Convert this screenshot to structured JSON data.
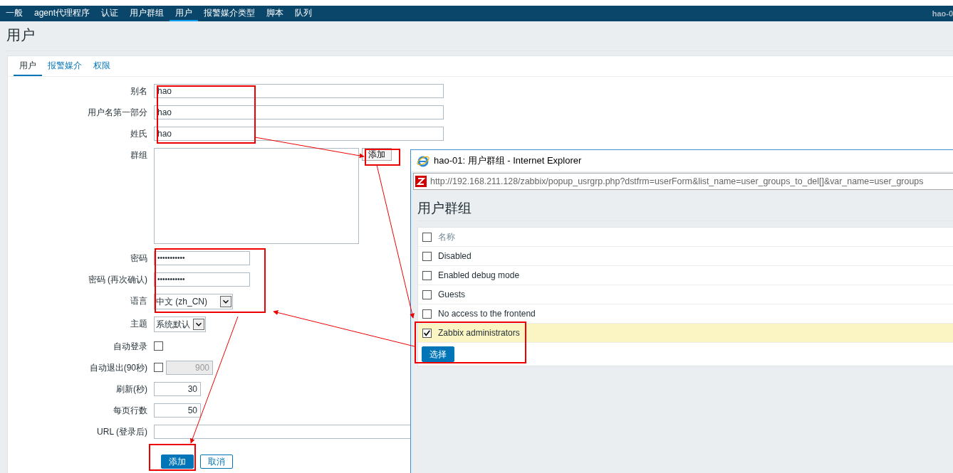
{
  "nav": {
    "items": [
      {
        "label": "一般",
        "selected": false
      },
      {
        "label": "agent代理程序",
        "selected": false
      },
      {
        "label": "认证",
        "selected": false
      },
      {
        "label": "用户群组",
        "selected": false
      },
      {
        "label": "用户",
        "selected": true
      },
      {
        "label": "报警媒介类型",
        "selected": false
      },
      {
        "label": "脚本",
        "selected": false
      },
      {
        "label": "队列",
        "selected": false
      }
    ],
    "host": "hao-0"
  },
  "page_title": "用户",
  "tabs": [
    {
      "label": "用户",
      "selected": true
    },
    {
      "label": "报警媒介",
      "selected": false
    },
    {
      "label": "权限",
      "selected": false
    }
  ],
  "form": {
    "rows": [
      {
        "kind": "text",
        "label": "别名",
        "value": "hao"
      },
      {
        "kind": "text",
        "label": "用户名第一部分",
        "value": "hao"
      },
      {
        "kind": "text",
        "label": "姓氏",
        "value": "hao"
      },
      {
        "kind": "groups",
        "label": "群组",
        "button": "添加"
      },
      {
        "kind": "password",
        "label": "密码",
        "value": "•••••••••••"
      },
      {
        "kind": "password",
        "label": "密码 (再次确认)",
        "value": "•••••••••••"
      },
      {
        "kind": "select",
        "label": "语言",
        "value": "中文 (zh_CN)"
      },
      {
        "kind": "select_small",
        "label": "主题",
        "value": "系统默认"
      },
      {
        "kind": "checkbox",
        "label": "自动登录",
        "checked": false
      },
      {
        "kind": "checkbox_number",
        "label": "自动退出(90秒)",
        "checked": false,
        "value": "900"
      },
      {
        "kind": "number",
        "label": "刷新(秒)",
        "value": "30"
      },
      {
        "kind": "number",
        "label": "每页行数",
        "value": "50"
      },
      {
        "kind": "url",
        "label": "URL (登录后)"
      }
    ],
    "buttons": [
      {
        "label": "添加",
        "primary": true
      },
      {
        "label": "取消",
        "primary": false
      }
    ]
  },
  "popup": {
    "title": "hao-01: 用户群组 - Internet Explorer",
    "url": "http://192.168.211.128/zabbix/popup_usrgrp.php?dstfrm=userForm&list_name=user_groups_to_del[]&var_name=user_groups",
    "heading": "用户群组",
    "table": {
      "header": {
        "label": "名称",
        "checked": false
      },
      "rows": [
        {
          "name": "Disabled",
          "checked": false
        },
        {
          "name": "Enabled debug mode",
          "checked": false
        },
        {
          "name": "Guests",
          "checked": false
        },
        {
          "name": "No access to the frontend",
          "checked": false
        },
        {
          "name": "Zabbix administrators",
          "checked": true
        }
      ]
    },
    "button": "选择"
  }
}
